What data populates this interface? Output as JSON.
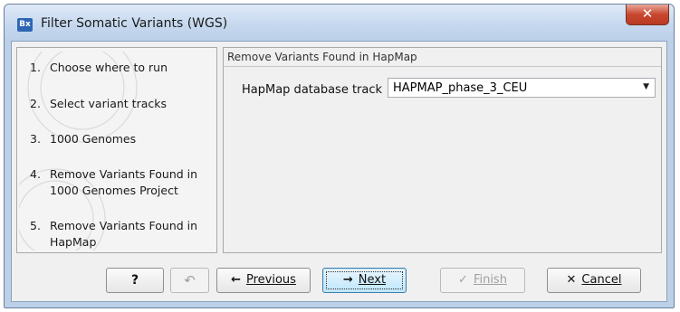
{
  "window": {
    "app_icon": "Bx",
    "title": "Filter Somatic Variants (WGS)",
    "close_icon": "✕"
  },
  "steps": [
    {
      "num": "1.",
      "label": "Choose where to run"
    },
    {
      "num": "2.",
      "label": "Select variant tracks"
    },
    {
      "num": "3.",
      "label": "1000 Genomes"
    },
    {
      "num": "4.",
      "label": "Remove Variants Found in 1000 Genomes Project"
    },
    {
      "num": "5.",
      "label": "Remove Variants Found in HapMap"
    }
  ],
  "content": {
    "section_title": "Remove Variants Found in HapMap",
    "field_label": "HapMap database track",
    "field_value": "HAPMAP_phase_3_CEU",
    "dropdown_icon": "▼"
  },
  "buttons": {
    "help_label": "?",
    "reset_icon": "↶",
    "previous": {
      "icon": "←",
      "label": "Previous"
    },
    "next": {
      "icon": "→",
      "label": "Next"
    },
    "finish": {
      "icon": "✓",
      "label": "Finish"
    },
    "cancel": {
      "icon": "✕",
      "label": "Cancel"
    }
  }
}
